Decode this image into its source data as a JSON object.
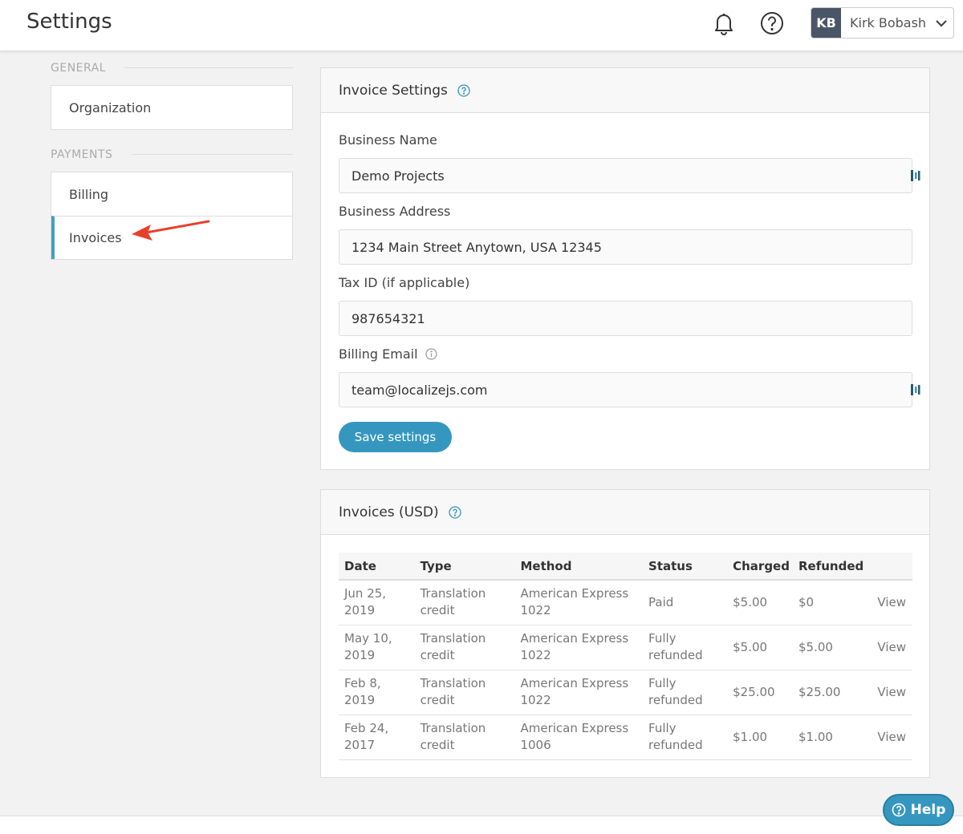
{
  "header": {
    "title": "Settings",
    "user": {
      "initials": "KB",
      "name": "Kirk Bobash"
    }
  },
  "sidebar": {
    "sections": [
      {
        "label": "GENERAL",
        "items": [
          {
            "label": "Organization",
            "active": false
          }
        ]
      },
      {
        "label": "PAYMENTS",
        "items": [
          {
            "label": "Billing",
            "active": false
          },
          {
            "label": "Invoices",
            "active": true
          }
        ]
      }
    ]
  },
  "invoice_settings": {
    "title": "Invoice Settings",
    "fields": [
      {
        "label": "Business Name",
        "value": "Demo Projects"
      },
      {
        "label": "Business Address",
        "value": "1234 Main Street Anytown, USA 12345"
      },
      {
        "label": "Tax ID (if applicable)",
        "value": "987654321"
      },
      {
        "label": "Billing Email",
        "value": "team@localizejs.com"
      }
    ],
    "save_label": "Save settings"
  },
  "invoices": {
    "title": "Invoices (USD)",
    "columns": [
      "Date",
      "Type",
      "Method",
      "Status",
      "Charged",
      "Refunded",
      ""
    ],
    "rows": [
      {
        "date": [
          "Jun 25,",
          "2019"
        ],
        "type": [
          "Translation",
          "credit"
        ],
        "method": [
          "American Express",
          "1022"
        ],
        "status": [
          "Paid"
        ],
        "charged": "$5.00",
        "refunded": "$0",
        "action": "View"
      },
      {
        "date": [
          "May 10,",
          "2019"
        ],
        "type": [
          "Translation",
          "credit"
        ],
        "method": [
          "American Express",
          "1022"
        ],
        "status": [
          "Fully",
          "refunded"
        ],
        "charged": "$5.00",
        "refunded": "$5.00",
        "action": "View"
      },
      {
        "date": [
          "Feb 8,",
          "2019"
        ],
        "type": [
          "Translation",
          "credit"
        ],
        "method": [
          "American Express",
          "1022"
        ],
        "status": [
          "Fully",
          "refunded"
        ],
        "charged": "$25.00",
        "refunded": "$25.00",
        "action": "View"
      },
      {
        "date": [
          "Feb 24,",
          "2017"
        ],
        "type": [
          "Translation",
          "credit"
        ],
        "method": [
          "American Express",
          "1006"
        ],
        "status": [
          "Fully",
          "refunded"
        ],
        "charged": "$1.00",
        "refunded": "$1.00",
        "action": "View"
      }
    ]
  },
  "help_button": {
    "label": "Help"
  },
  "colors": {
    "accent": "#3597bf",
    "avatar_bg": "#4a5666",
    "arrow": "#e8402c"
  }
}
